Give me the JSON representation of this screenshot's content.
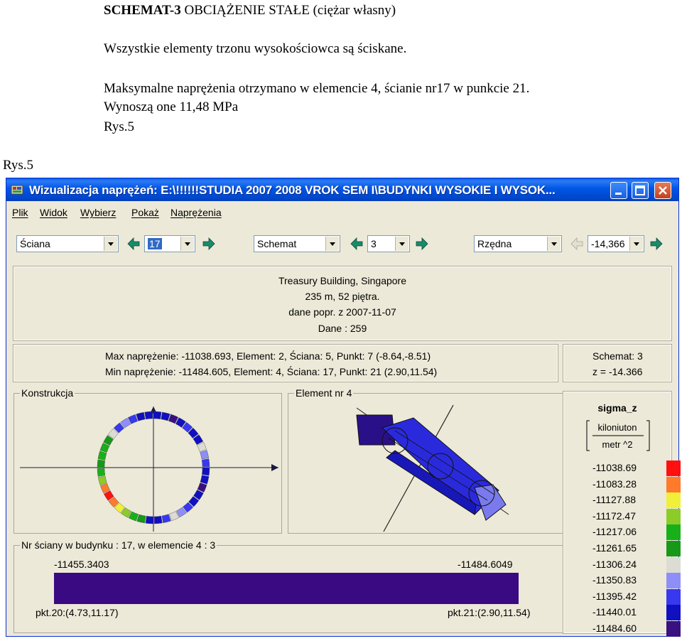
{
  "doc": {
    "title_bold": "SCHEMAT-3",
    "title_rest": " OBCIĄŻENIE STAŁE (ciężar własny)",
    "line1": "Wszystkie elementy trzonu wysokościowca są ściskane.",
    "line2": "Maksymalne naprężenia otrzymano w elemencie 4, ścianie  nr17 w punkcie 21.",
    "line3": "Wynoszą one 11,48 MPa",
    "line4": "Rys.5",
    "left_caption": "Rys.5"
  },
  "window": {
    "title": "Wizualizacja naprężeń: E:\\!!!!!!STUDIA 2007 2008 VROK SEM I\\BUDYNKI WYSOKIE I WYSOK...",
    "menu": [
      "Plik",
      "Widok",
      "Wybierz",
      "Pokaż",
      "Naprężenia"
    ]
  },
  "toolbar": {
    "combo1": "Ściana",
    "combo1_value": "17",
    "combo2": "Schemat",
    "combo2_value": "3",
    "combo3": "Rzędna",
    "combo3_value": "-14,366"
  },
  "info": {
    "line1": "Treasury Building, Singapore",
    "line2": "235 m, 52 piętra.",
    "line3": "dane popr. z 2007-11-07",
    "line4": "Dane :   259"
  },
  "stats": {
    "max": "Max naprężenie: -11038.693,   Element: 2,   Ściana: 5,   Punkt: 7 (-8.64,-8.51)",
    "min": "Min naprężenie: -11484.605,   Element: 4,   Ściana: 17,   Punkt: 21 (2.90,11.54)",
    "schemat": "Schemat: 3",
    "z": "z = -14.366"
  },
  "groups": {
    "konstrukcja": "Konstrukcja",
    "element": "Element nr 4",
    "nr_sciany": "Nr ściany w budynku :  17,    w elemencie 4 :  3"
  },
  "legend": {
    "title": "sigma_z",
    "unit_num": "kiloniuton",
    "unit_den": "metr ^2",
    "items": [
      {
        "value": "-11038.69",
        "color": "#ff1010"
      },
      {
        "value": "-11083.28",
        "color": "#ff7a2a"
      },
      {
        "value": "-11127.88",
        "color": "#f0f03a"
      },
      {
        "value": "-11172.47",
        "color": "#8ccc28"
      },
      {
        "value": "-11217.06",
        "color": "#18b018"
      },
      {
        "value": "-11261.65",
        "color": "#189818"
      },
      {
        "value": "-11306.24",
        "color": "#dcdcd4"
      },
      {
        "value": "-11350.83",
        "color": "#8e8ef8"
      },
      {
        "value": "-11395.42",
        "color": "#3838f0"
      },
      {
        "value": "-11440.01",
        "color": "#1010c0"
      },
      {
        "value": "-11484.60",
        "color": "#3a1080"
      }
    ]
  },
  "bar": {
    "left_value": "-11455.3403",
    "right_value": "-11484.6049",
    "left_point": "pkt.20:(4.73,11.17)",
    "right_point": "pkt.21:(2.90,11.54)",
    "color": "#3a0a82"
  }
}
